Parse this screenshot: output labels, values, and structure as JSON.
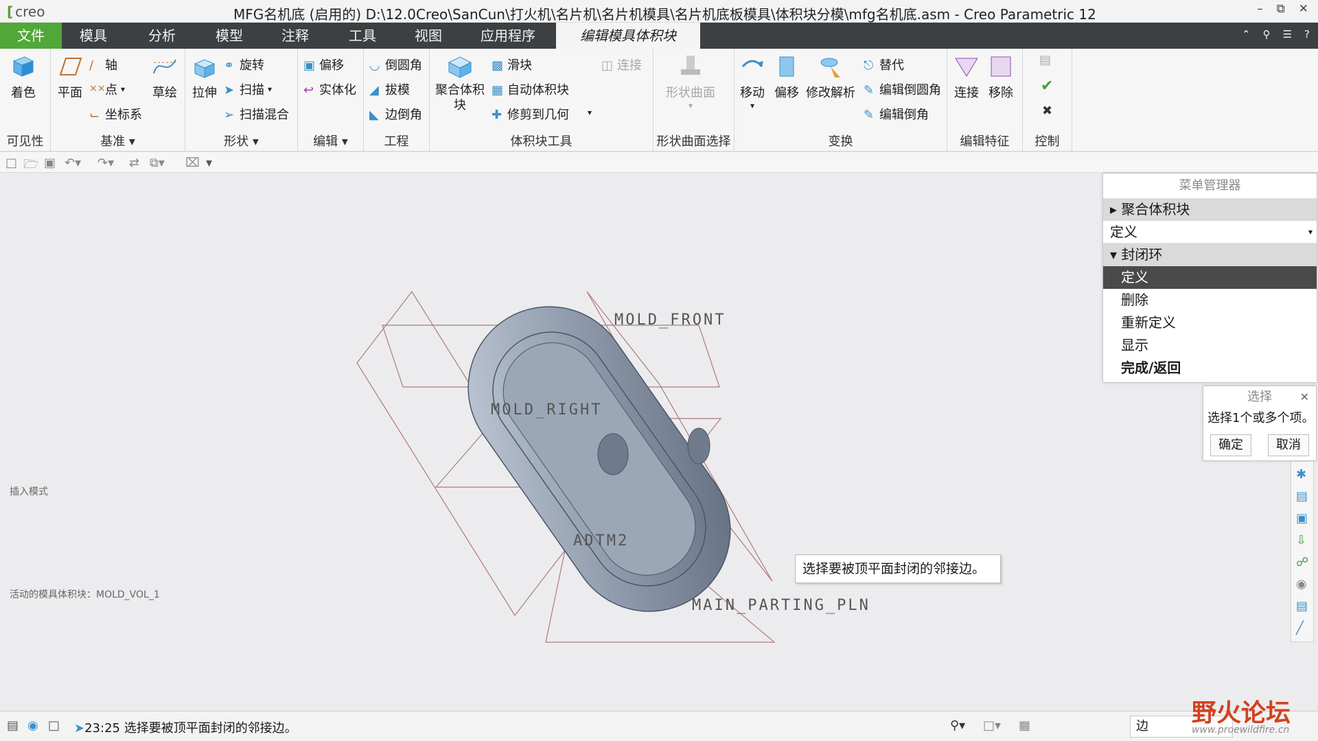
{
  "window": {
    "app_logo": "creo",
    "title": "MFG名机底 (启用的) D:\\12.0Creo\\SanCun\\打火机\\名片机\\名片机模具\\名片机底板模具\\体积块分模\\mfg名机底.asm - Creo Parametric 12"
  },
  "tabs": [
    "文件",
    "模具",
    "分析",
    "模型",
    "注释",
    "工具",
    "视图",
    "应用程序",
    "编辑模具体积块"
  ],
  "ribbon": {
    "visibility": {
      "label": "可见性",
      "shade": "着色"
    },
    "datum": {
      "label": "基准",
      "plane": "平面",
      "axis": "轴",
      "point": "点",
      "csys": "坐标系",
      "sketch": "草绘"
    },
    "shapes": {
      "label": "形状",
      "extrude": "拉伸",
      "revolve": "旋转",
      "sweep": "扫描",
      "swept_blend": "扫描混合"
    },
    "editing": {
      "label": "编辑",
      "offset": "偏移",
      "solidify": "实体化"
    },
    "engineering": {
      "label": "工程",
      "round": "倒圆角",
      "draft": "拔模",
      "chamfer": "边倒角"
    },
    "volume_tools": {
      "label": "体积块工具",
      "gather": "聚合体积块",
      "slider": "滑块",
      "auto_volume": "自动体积块",
      "trim": "修剪到几何",
      "connect": "连接"
    },
    "shape_surface": {
      "label": "形状曲面选择",
      "shape_surface": "形状曲面"
    },
    "transform": {
      "label": "变换",
      "move": "移动",
      "offset": "偏移",
      "modify": "修改解析",
      "replace": "替代",
      "edit_round": "编辑倒圆角",
      "edit_chamfer": "编辑倒角"
    },
    "edit_feature": {
      "label": "编辑特征",
      "connect": "连接",
      "remove": "移除"
    },
    "control": {
      "label": "控制"
    }
  },
  "viewport": {
    "planes": {
      "front": "MOLD_FRONT",
      "right": "MOLD_RIGHT",
      "adtm": "ADTM2",
      "parting": "MAIN_PARTING_PLN"
    },
    "insert_mode": "插入模式",
    "active_volume": "活动的模具体积块：MOLD_VOL_1",
    "tooltip": "选择要被顶平面封闭的邻接边。"
  },
  "menu_manager": {
    "title": "菜单管理器",
    "gather": "聚合体积块",
    "dropdown": "定义",
    "close_loop": "封闭环",
    "items": [
      "定义",
      "删除",
      "重新定义",
      "显示",
      "完成/返回"
    ]
  },
  "select_dialog": {
    "title": "选择",
    "message": "选择1个或多个项。",
    "ok": "确定",
    "cancel": "取消"
  },
  "statusbar": {
    "message": "23:25 选择要被顶平面封闭的邻接边。",
    "filter": "边"
  },
  "watermark": {
    "cn": "野火论坛",
    "url": "www.proewildfire.cn"
  },
  "colors": {
    "file_tab": "#51a838",
    "tabbar": "#3c4042",
    "part": "#8e9aab"
  }
}
